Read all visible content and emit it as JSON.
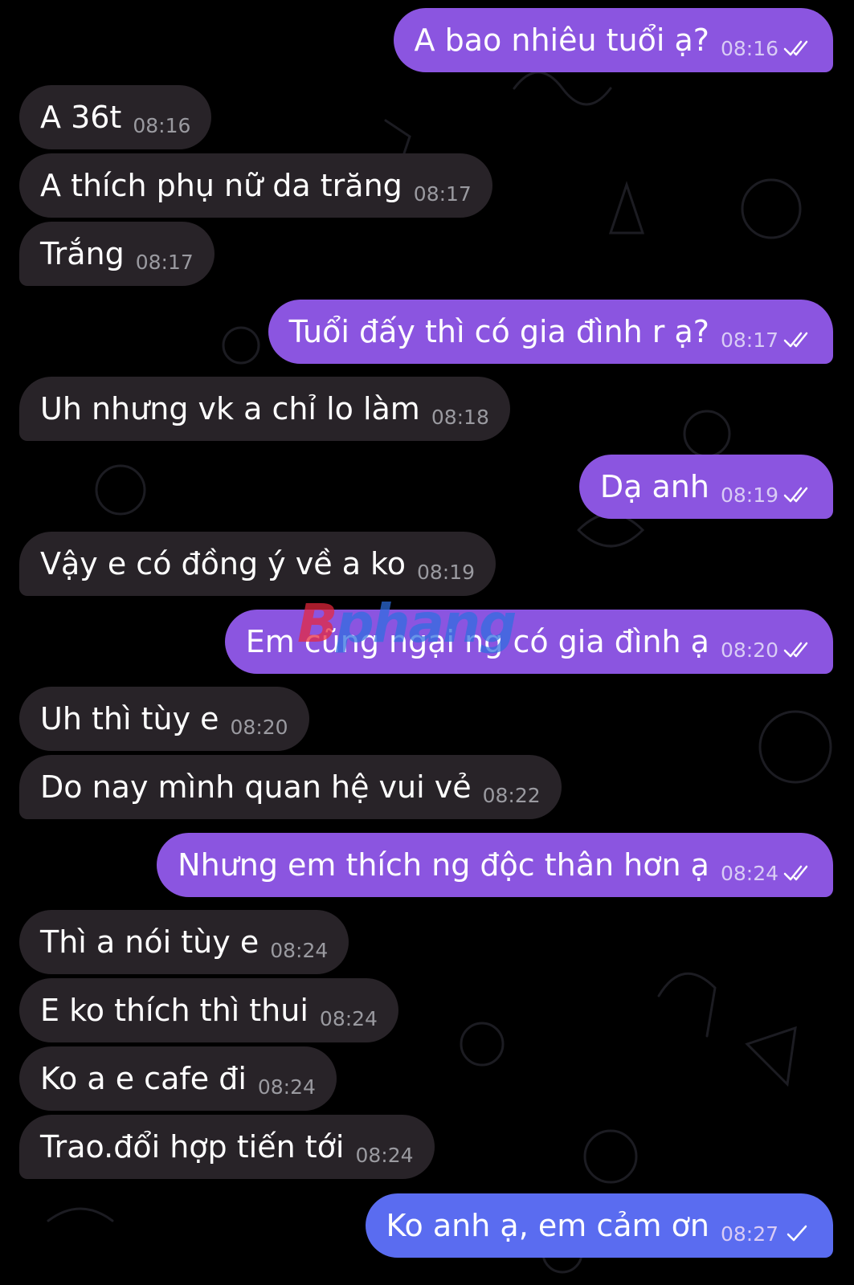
{
  "watermark": {
    "part1": "B",
    "part2": "phang"
  },
  "messages": [
    {
      "dir": "out",
      "text": "A bao nhiêu tuổi ạ?",
      "time": "08:16",
      "ticks": "double"
    },
    {
      "dir": "in",
      "text": "A 36t",
      "time": "08:16"
    },
    {
      "dir": "in",
      "text": "A thích phụ nữ da trăng",
      "time": "08:17"
    },
    {
      "dir": "in",
      "text": "Trắng",
      "time": "08:17"
    },
    {
      "dir": "out",
      "text": "Tuổi đấy thì có gia đình r ạ?",
      "time": "08:17",
      "ticks": "double"
    },
    {
      "dir": "in",
      "text": "Uh nhưng vk a chỉ lo làm",
      "time": "08:18"
    },
    {
      "dir": "out",
      "text": "Dạ anh",
      "time": "08:19",
      "ticks": "double"
    },
    {
      "dir": "in",
      "text": "Vậy e có đồng ý về a ko",
      "time": "08:19"
    },
    {
      "dir": "out",
      "text": "Em cũng ngại ng có gia đình ạ",
      "time": "08:20",
      "ticks": "double"
    },
    {
      "dir": "in",
      "text": "Uh thì tùy e",
      "time": "08:20"
    },
    {
      "dir": "in",
      "text": "Do nay mình quan hệ vui vẻ",
      "time": "08:22"
    },
    {
      "dir": "out",
      "text": "Nhưng em thích ng độc thân hơn ạ",
      "time": "08:24",
      "ticks": "double"
    },
    {
      "dir": "in",
      "text": "Thì a nói tùy e",
      "time": "08:24"
    },
    {
      "dir": "in",
      "text": "E ko thích thì thui",
      "time": "08:24"
    },
    {
      "dir": "in",
      "text": "Ko a e cafe đi",
      "time": "08:24"
    },
    {
      "dir": "in",
      "text": "Trao.đổi hợp tiến tới",
      "time": "08:24"
    },
    {
      "dir": "out",
      "text": "Ko anh ạ, em cảm ơn",
      "time": "08:27",
      "ticks": "single"
    }
  ]
}
